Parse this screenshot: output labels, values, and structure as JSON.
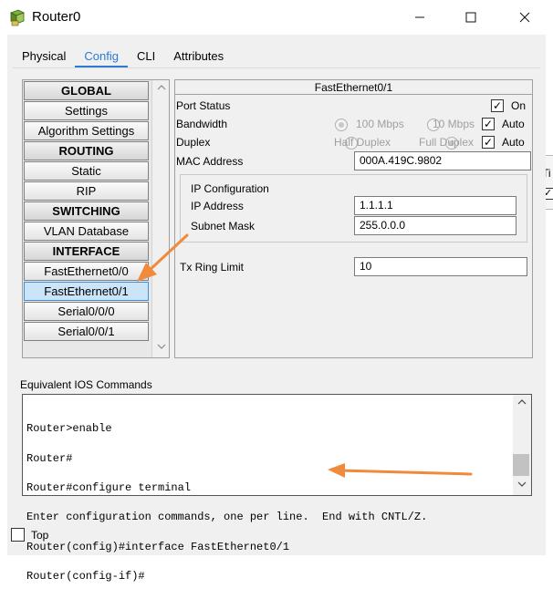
{
  "window": {
    "title": "Router0"
  },
  "tabs": [
    {
      "label": "Physical",
      "active": false
    },
    {
      "label": "Config",
      "active": true
    },
    {
      "label": "CLI",
      "active": false
    },
    {
      "label": "Attributes",
      "active": false
    }
  ],
  "sidebar": {
    "items": [
      {
        "label": "GLOBAL",
        "header": true
      },
      {
        "label": "Settings"
      },
      {
        "label": "Algorithm Settings"
      },
      {
        "label": "ROUTING",
        "header": true
      },
      {
        "label": "Static"
      },
      {
        "label": "RIP"
      },
      {
        "label": "SWITCHING",
        "header": true
      },
      {
        "label": "VLAN Database"
      },
      {
        "label": "INTERFACE",
        "header": true
      },
      {
        "label": "FastEthernet0/0"
      },
      {
        "label": "FastEthernet0/1",
        "selected": true
      },
      {
        "label": "Serial0/0/0"
      },
      {
        "label": "Serial0/0/1"
      }
    ]
  },
  "interface": {
    "title": "FastEthernet0/1",
    "port_status_label": "Port Status",
    "on_label": "On",
    "bandwidth_label": "Bandwidth",
    "bw_100": "100 Mbps",
    "bw_10": "10 Mbps",
    "auto_label": "Auto",
    "duplex_label": "Duplex",
    "half_duplex": "Half Duplex",
    "full_duplex": "Full Duplex",
    "mac_label": "MAC Address",
    "mac_value": "000A.419C.9802",
    "ip_config_label": "IP Configuration",
    "ip_label": "IP Address",
    "ip_value": "1.1.1.1",
    "mask_label": "Subnet Mask",
    "mask_value": "255.0.0.0",
    "tx_label": "Tx Ring Limit",
    "tx_value": "10"
  },
  "ios": {
    "label": "Equivalent IOS Commands",
    "lines": [
      "Router>enable",
      "Router#",
      "Router#configure terminal",
      "Enter configuration commands, one per line.  End with CNTL/Z.",
      "Router(config)#interface FastEthernet0/1",
      "Router(config-if)#"
    ]
  },
  "bottom": {
    "top_label": "Top"
  },
  "background_window": {
    "text": "Ti"
  },
  "colors": {
    "accent": "#2a7ad6",
    "annotation": "#f08a3c",
    "selected": "#cce4f7"
  }
}
